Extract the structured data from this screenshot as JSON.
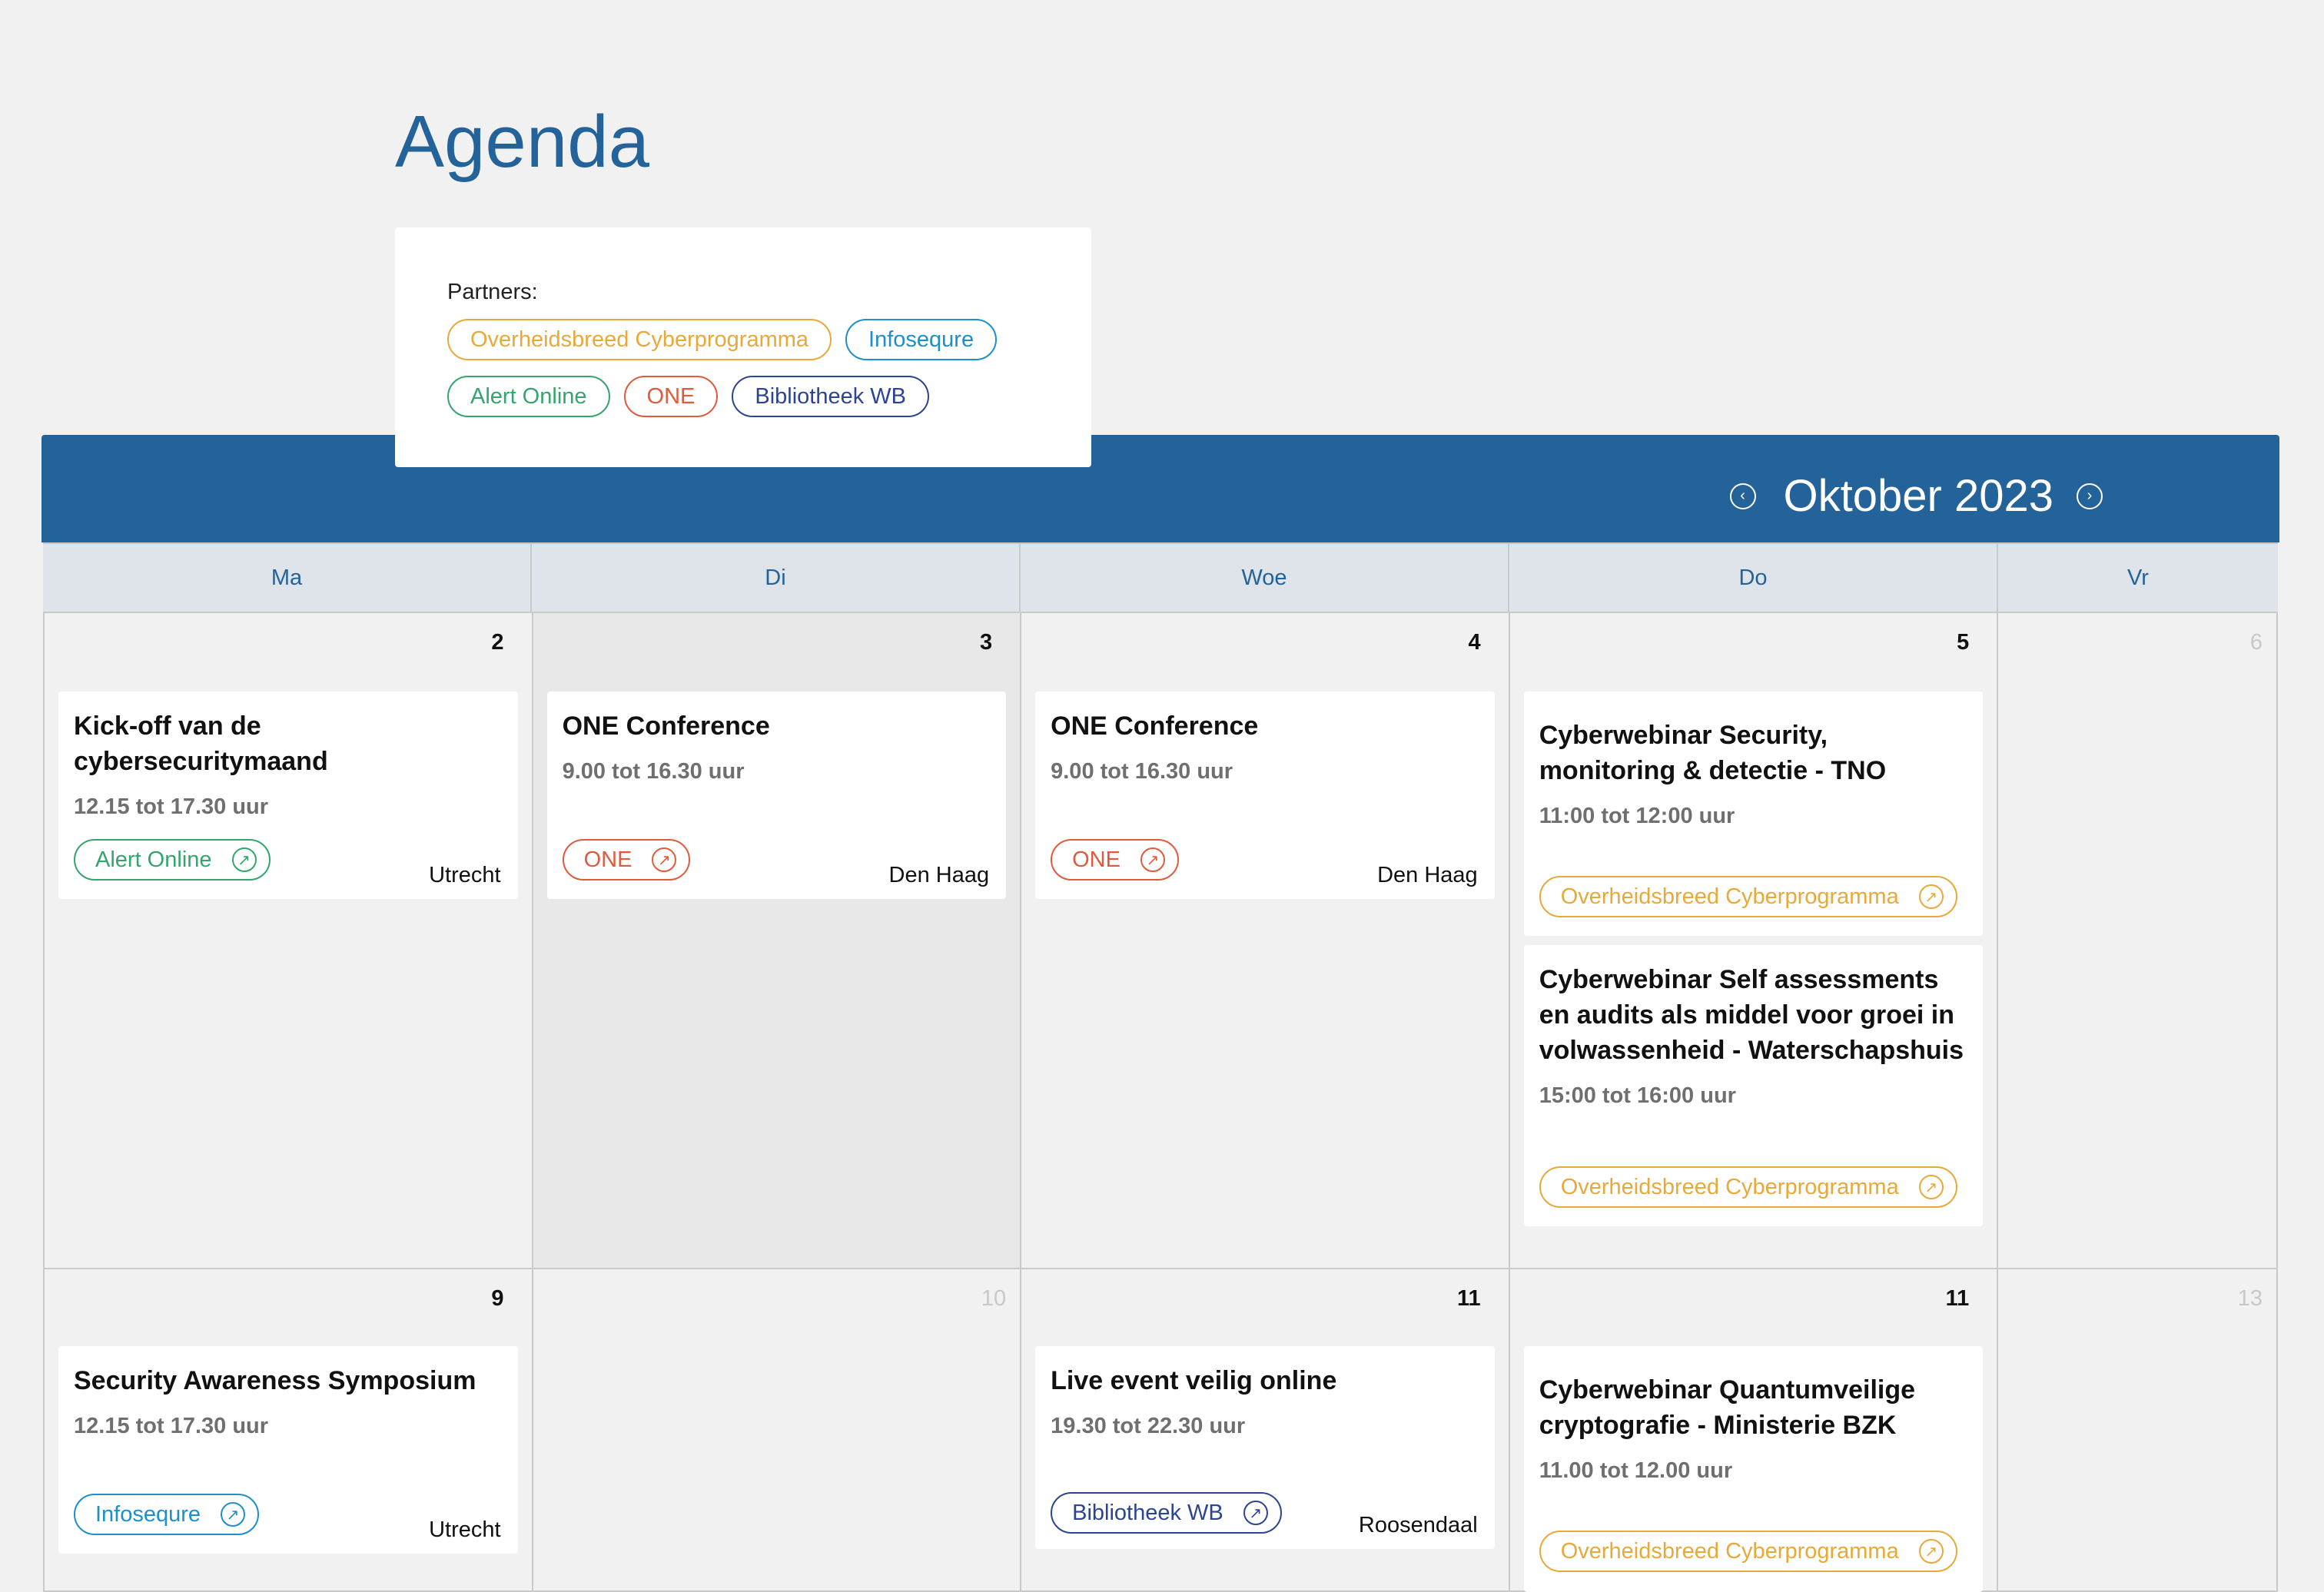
{
  "page": {
    "title": "Agenda"
  },
  "partners": {
    "label": "Partners:",
    "chips": [
      {
        "label": "Overheidsbreed Cyberprogramma",
        "color": "#e8a93b"
      },
      {
        "label": "Infosequre",
        "color": "#1d8fcb"
      },
      {
        "label": "Alert Online",
        "color": "#34a56d"
      },
      {
        "label": "ONE",
        "color": "#e05a3e"
      },
      {
        "label": "Bibliotheek WB",
        "color": "#2c4494"
      }
    ]
  },
  "calendar": {
    "month_label": "Oktober 2023",
    "prev_icon": "chevron-left-icon",
    "next_icon": "chevron-right-icon",
    "header_color": "#24629a",
    "weekdays": [
      "Ma",
      "Di",
      "Woe",
      "Do",
      "Vr"
    ],
    "week1": {
      "days": [
        "2",
        "3",
        "4",
        "5",
        "6"
      ],
      "events": [
        {
          "title": "Kick-off van de cybersecuritymaand",
          "time": "12.15 tot 17.30 uur",
          "partner": "Alert Online",
          "location": "Utrecht"
        },
        {
          "title": "ONE Conference",
          "time": "9.00 tot 16.30 uur",
          "partner": "ONE",
          "location": "Den Haag"
        },
        {
          "title": "ONE Conference",
          "time": "9.00 tot 16.30 uur",
          "partner": "ONE",
          "location": "Den Haag"
        },
        {
          "title": "Cyberwebinar Security, monitoring & detectie - TNO",
          "time": "11:00 tot 12:00 uur",
          "partner": "Overheidsbreed Cyberprogramma"
        },
        {
          "title": "Cyberwebinar Self assessments en audits als middel voor groei in volwassenheid - Waterschapshuis",
          "time": "15:00 tot 16:00 uur",
          "partner": "Overheidsbreed Cyberprogramma"
        }
      ]
    },
    "week2": {
      "days": [
        "9",
        "10",
        "11",
        "11",
        "13"
      ],
      "events": [
        {
          "title": "Security Awareness Symposium",
          "time": "12.15 tot 17.30 uur",
          "partner": "Infosequre",
          "location": "Utrecht"
        },
        {
          "title": "Live event veilig online",
          "time": "19.30 tot 22.30 uur",
          "partner": "Bibliotheek WB",
          "location": "Roosendaal"
        },
        {
          "title": "Cyberwebinar Quantumveilige cryptografie - Ministerie BZK",
          "time": "11.00 tot 12.00 uur",
          "partner": "Overheidsbreed Cyberprogramma"
        }
      ]
    }
  }
}
